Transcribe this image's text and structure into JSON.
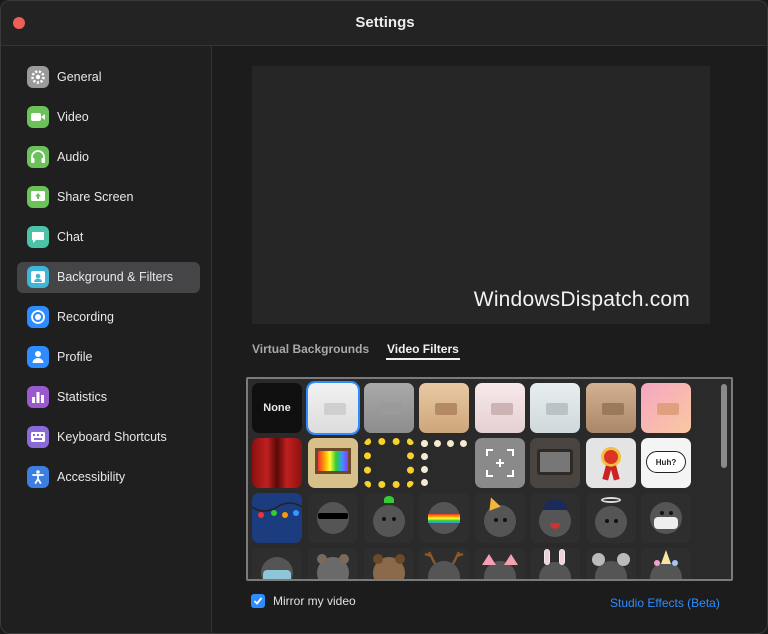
{
  "window": {
    "title": "Settings"
  },
  "sidebar": {
    "items": [
      {
        "label": "General",
        "icon": "gear-icon",
        "color": "#9a9a9a",
        "active": false
      },
      {
        "label": "Video",
        "icon": "video-camera-icon",
        "color": "#6ac259",
        "active": false
      },
      {
        "label": "Audio",
        "icon": "headphones-icon",
        "color": "#6ac259",
        "active": false
      },
      {
        "label": "Share Screen",
        "icon": "share-screen-icon",
        "color": "#6ac259",
        "active": false
      },
      {
        "label": "Chat",
        "icon": "chat-bubble-icon",
        "color": "#4cc3a6",
        "active": false
      },
      {
        "label": "Background & Filters",
        "icon": "background-icon",
        "color": "#3fb6d8",
        "active": true
      },
      {
        "label": "Recording",
        "icon": "record-icon",
        "color": "#2d8cff",
        "active": false
      },
      {
        "label": "Profile",
        "icon": "person-icon",
        "color": "#2d8cff",
        "active": false
      },
      {
        "label": "Statistics",
        "icon": "bar-chart-icon",
        "color": "#9b59d0",
        "active": false
      },
      {
        "label": "Keyboard Shortcuts",
        "icon": "keyboard-icon",
        "color": "#8a6ad8",
        "active": false
      },
      {
        "label": "Accessibility",
        "icon": "accessibility-icon",
        "color": "#3d7fe0",
        "active": false
      }
    ]
  },
  "preview": {
    "watermark": "WindowsDispatch.com"
  },
  "tabs": [
    {
      "label": "Virtual Backgrounds",
      "active": false
    },
    {
      "label": "Video Filters",
      "active": true
    }
  ],
  "filters": {
    "none_label": "None",
    "huh_label": "Huh?",
    "rows": [
      [
        "none",
        "white-room-filter",
        "gray-room-filter",
        "peach-room-filter",
        "pink-room-filter",
        "light-blue-room-filter",
        "tan-room-filter",
        "pastel-gradient-room-filter"
      ],
      [
        "theater-curtain-filter",
        "retro-tv-filter",
        "emoji-frame-filter",
        "light-bulb-frame-filter",
        "viewfinder-filter",
        "old-tv-filter",
        "award-ribbon-filter",
        "speech-bubble-filter"
      ],
      [
        "string-lights-filter",
        "sunglasses-face-filter",
        "sprout-face-filter",
        "rainbow-face-filter",
        "party-hat-face-filter",
        "cap-face-filter",
        "halo-face-filter",
        "mask-face-filter"
      ],
      [
        "medical-mask-face-filter",
        "bear-ears-filter",
        "brown-bear-filter",
        "reindeer-antlers-filter",
        "pig-ears-filter",
        "bunny-ears-filter",
        "mouse-ears-filter",
        "unicorn-horn-filter"
      ]
    ]
  },
  "footer": {
    "mirror_label": "Mirror my video",
    "mirror_checked": true,
    "studio_effects": "Studio Effects (Beta)"
  }
}
